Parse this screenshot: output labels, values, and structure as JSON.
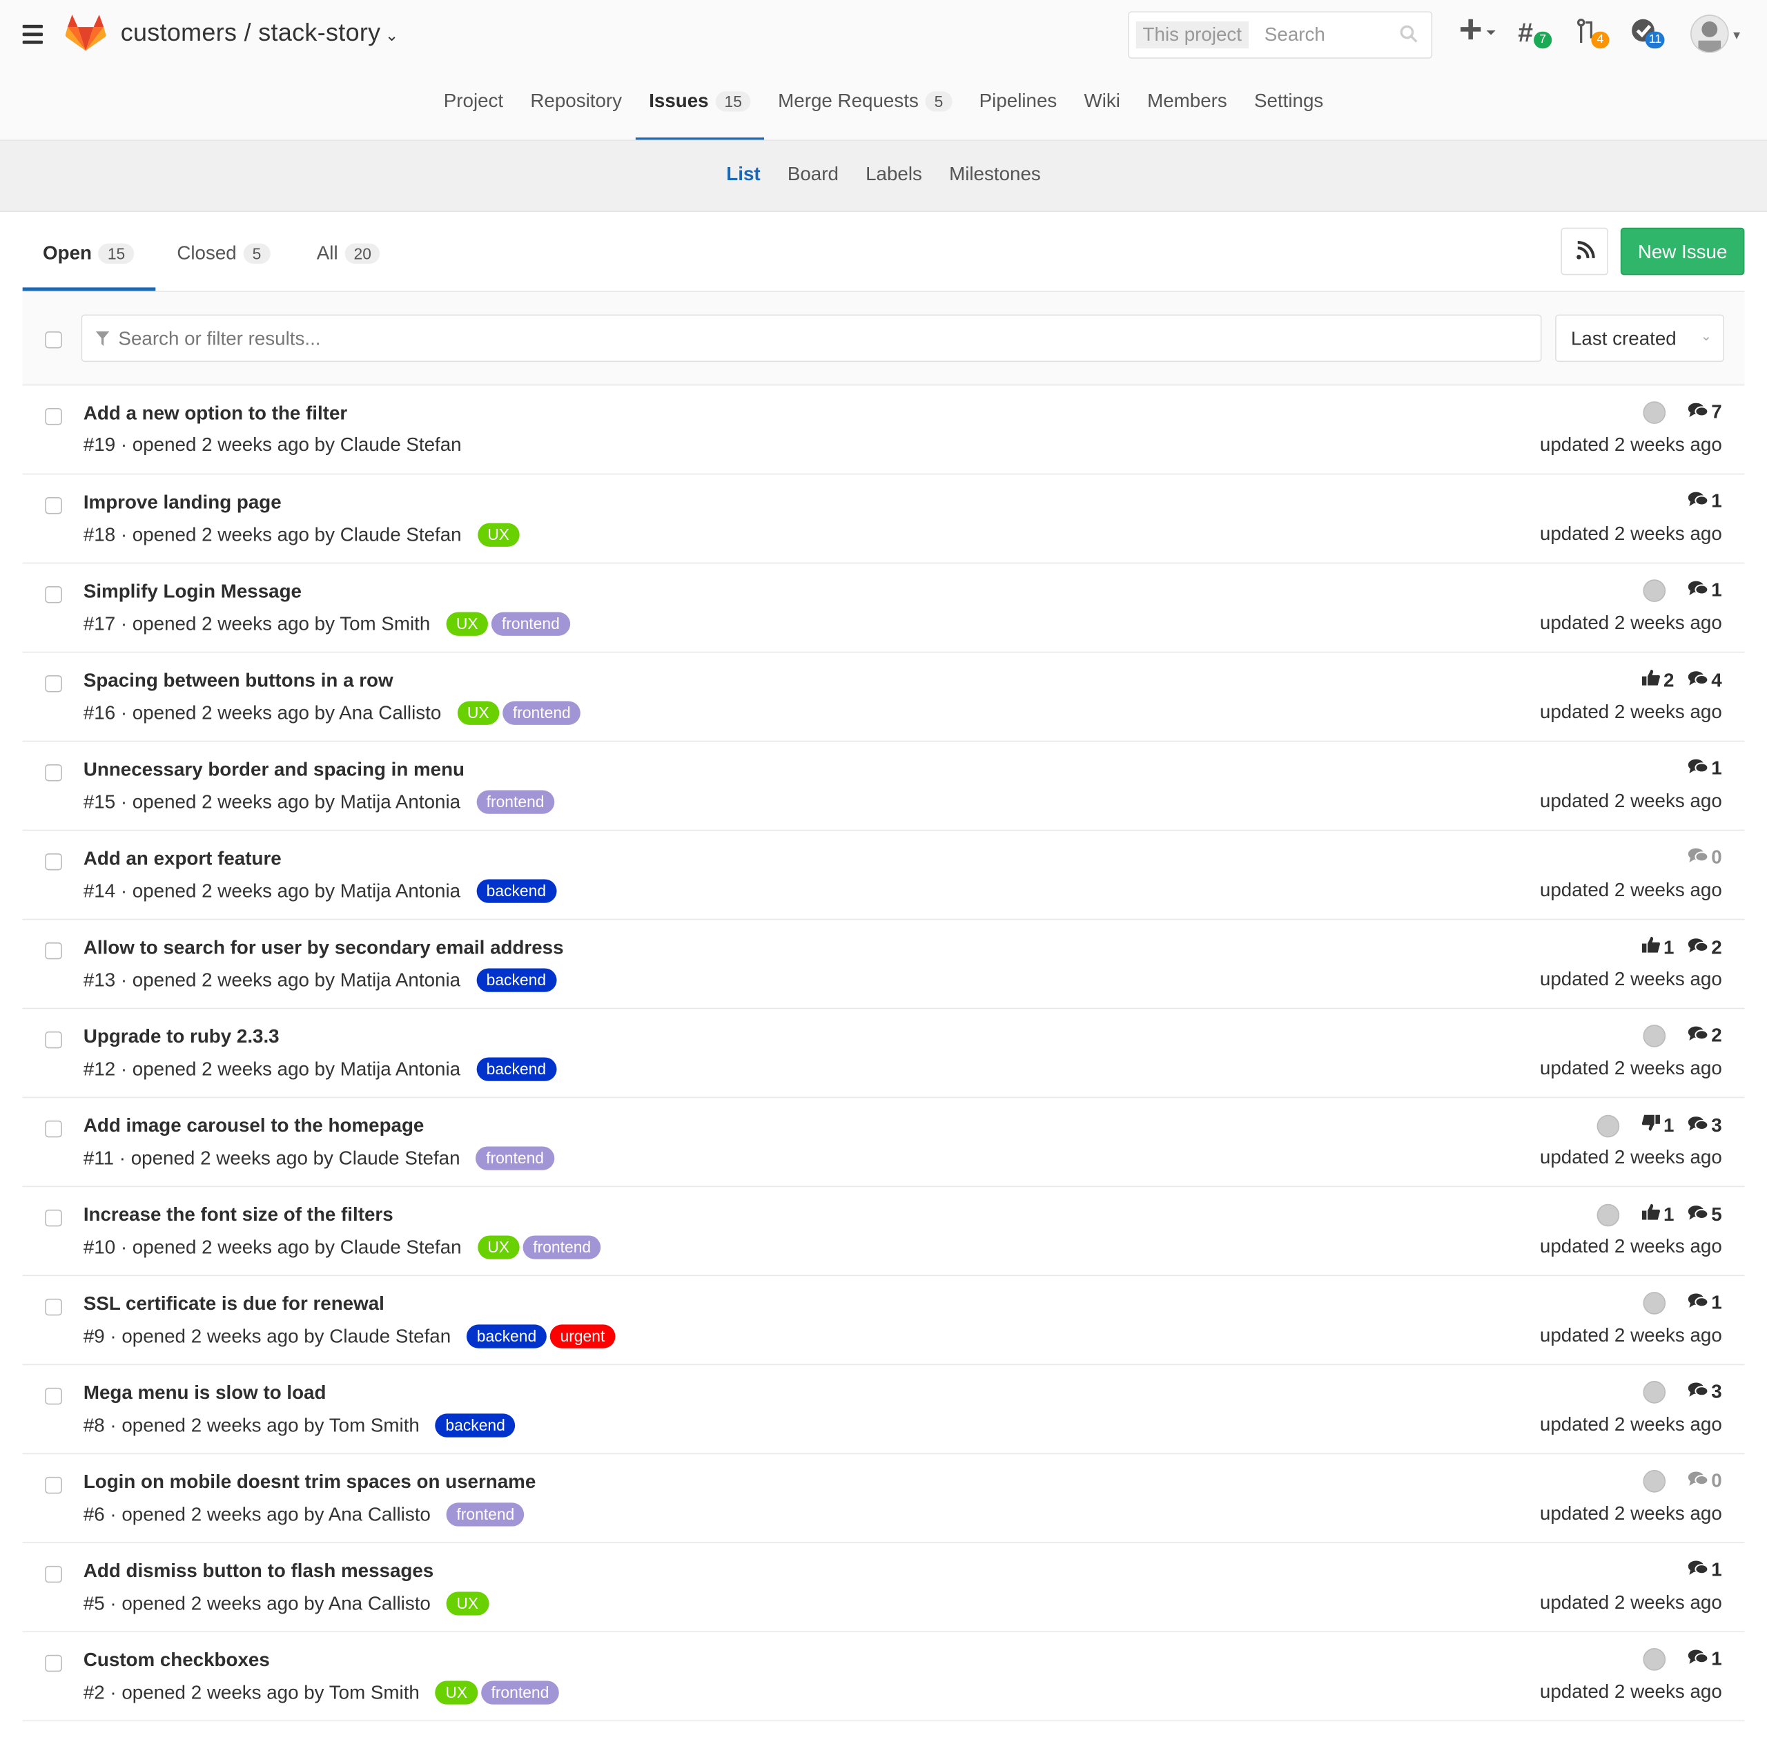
{
  "header": {
    "project_path": "customers / stack-story",
    "search_scope": "This project",
    "search_placeholder": "Search",
    "todo_count": "7",
    "mr_count": "4",
    "issues_count": "11"
  },
  "main_nav": [
    {
      "label": "Project",
      "count": null,
      "active": false
    },
    {
      "label": "Repository",
      "count": null,
      "active": false
    },
    {
      "label": "Issues",
      "count": "15",
      "active": true
    },
    {
      "label": "Merge Requests",
      "count": "5",
      "active": false
    },
    {
      "label": "Pipelines",
      "count": null,
      "active": false
    },
    {
      "label": "Wiki",
      "count": null,
      "active": false
    },
    {
      "label": "Members",
      "count": null,
      "active": false
    },
    {
      "label": "Settings",
      "count": null,
      "active": false
    }
  ],
  "sub_nav": [
    {
      "label": "List",
      "active": true
    },
    {
      "label": "Board",
      "active": false
    },
    {
      "label": "Labels",
      "active": false
    },
    {
      "label": "Milestones",
      "active": false
    }
  ],
  "state_tabs": {
    "open": {
      "label": "Open",
      "count": "15"
    },
    "closed": {
      "label": "Closed",
      "count": "5"
    },
    "all": {
      "label": "All",
      "count": "20"
    }
  },
  "new_issue_label": "New Issue",
  "filter_placeholder": "Search or filter results...",
  "sort_label": "Last created",
  "label_colors": {
    "UX": "#69d100",
    "frontend": "#a295d6",
    "backend": "#0033cc",
    "urgent": "#ff0000"
  },
  "issues": [
    {
      "title": "Add a new option to the filter",
      "meta": "#19 · opened 2 weeks ago by Claude Stefan",
      "labels": [],
      "avatar": true,
      "up": null,
      "down": null,
      "comments": "7",
      "updated": "updated 2 weeks ago"
    },
    {
      "title": "Improve landing page",
      "meta": "#18 · opened 2 weeks ago by Claude Stefan",
      "labels": [
        "UX"
      ],
      "avatar": false,
      "up": null,
      "down": null,
      "comments": "1",
      "updated": "updated 2 weeks ago"
    },
    {
      "title": "Simplify Login Message",
      "meta": "#17 · opened 2 weeks ago by Tom Smith",
      "labels": [
        "UX",
        "frontend"
      ],
      "avatar": true,
      "up": null,
      "down": null,
      "comments": "1",
      "updated": "updated 2 weeks ago"
    },
    {
      "title": "Spacing between buttons in a row",
      "meta": "#16 · opened 2 weeks ago by Ana Callisto",
      "labels": [
        "UX",
        "frontend"
      ],
      "avatar": false,
      "up": "2",
      "down": null,
      "comments": "4",
      "updated": "updated 2 weeks ago"
    },
    {
      "title": "Unnecessary border and spacing in menu",
      "meta": "#15 · opened 2 weeks ago by Matija Antonia",
      "labels": [
        "frontend"
      ],
      "avatar": false,
      "up": null,
      "down": null,
      "comments": "1",
      "updated": "updated 2 weeks ago"
    },
    {
      "title": "Add an export feature",
      "meta": "#14 · opened 2 weeks ago by Matija Antonia",
      "labels": [
        "backend"
      ],
      "avatar": false,
      "up": null,
      "down": null,
      "comments": "0",
      "updated": "updated 2 weeks ago"
    },
    {
      "title": "Allow to search for user by secondary email address",
      "meta": "#13 · opened 2 weeks ago by Matija Antonia",
      "labels": [
        "backend"
      ],
      "avatar": false,
      "up": "1",
      "down": null,
      "comments": "2",
      "updated": "updated 2 weeks ago"
    },
    {
      "title": "Upgrade to ruby 2.3.3",
      "meta": "#12 · opened 2 weeks ago by Matija Antonia",
      "labels": [
        "backend"
      ],
      "avatar": true,
      "up": null,
      "down": null,
      "comments": "2",
      "updated": "updated 2 weeks ago"
    },
    {
      "title": "Add image carousel to the homepage",
      "meta": "#11 · opened 2 weeks ago by Claude Stefan",
      "labels": [
        "frontend"
      ],
      "avatar": true,
      "up": null,
      "down": "1",
      "comments": "3",
      "updated": "updated 2 weeks ago"
    },
    {
      "title": "Increase the font size of the filters",
      "meta": "#10 · opened 2 weeks ago by Claude Stefan",
      "labels": [
        "UX",
        "frontend"
      ],
      "avatar": true,
      "up": "1",
      "down": null,
      "comments": "5",
      "updated": "updated 2 weeks ago"
    },
    {
      "title": "SSL certificate is due for renewal",
      "meta": "#9 · opened 2 weeks ago by Claude Stefan",
      "labels": [
        "backend",
        "urgent"
      ],
      "avatar": true,
      "up": null,
      "down": null,
      "comments": "1",
      "updated": "updated 2 weeks ago"
    },
    {
      "title": "Mega menu is slow to load",
      "meta": "#8 · opened 2 weeks ago by Tom Smith",
      "labels": [
        "backend"
      ],
      "avatar": true,
      "up": null,
      "down": null,
      "comments": "3",
      "updated": "updated 2 weeks ago"
    },
    {
      "title": "Login on mobile doesnt trim spaces on username",
      "meta": "#6 · opened 2 weeks ago by Ana Callisto",
      "labels": [
        "frontend"
      ],
      "avatar": true,
      "up": null,
      "down": null,
      "comments": "0",
      "updated": "updated 2 weeks ago"
    },
    {
      "title": "Add dismiss button to flash messages",
      "meta": "#5 · opened 2 weeks ago by Ana Callisto",
      "labels": [
        "UX"
      ],
      "avatar": false,
      "up": null,
      "down": null,
      "comments": "1",
      "updated": "updated 2 weeks ago"
    },
    {
      "title": "Custom checkboxes",
      "meta": "#2 · opened 2 weeks ago by Tom Smith",
      "labels": [
        "UX",
        "frontend"
      ],
      "avatar": true,
      "up": null,
      "down": null,
      "comments": "1",
      "updated": "updated 2 weeks ago"
    }
  ]
}
